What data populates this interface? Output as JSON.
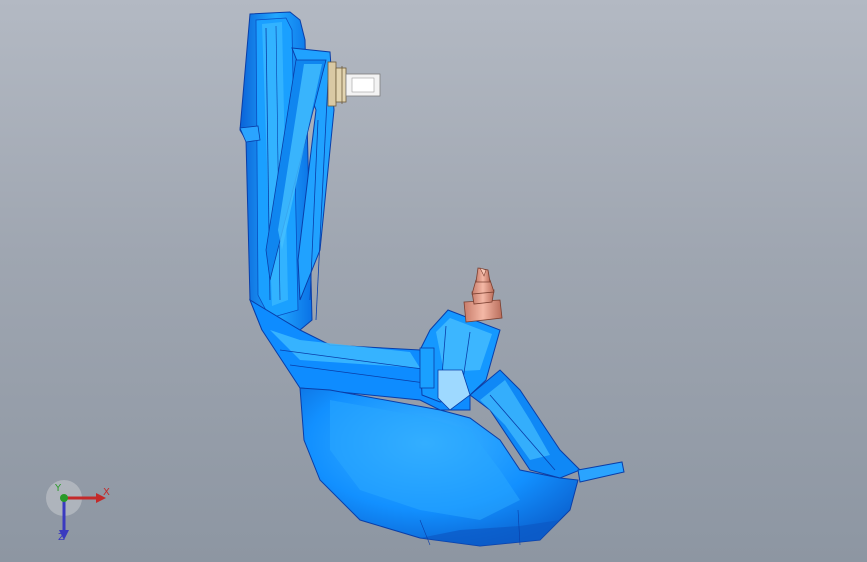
{
  "viewport": {
    "background_top": "#b3b9c3",
    "background_bottom": "#8d96a2"
  },
  "model": {
    "part_color": "#0f8cff",
    "part_highlight": "#57c7ff",
    "part_edge": "#0a3ea8",
    "connector_color": "#f2f2f2",
    "fastener_color": "#e8a08a"
  },
  "triad": {
    "x_label": "X",
    "y_label": "Y",
    "z_label": "Z",
    "x_color": "#c42a2a",
    "y_color": "#2a9a2a",
    "z_color": "#3a3ac0"
  }
}
